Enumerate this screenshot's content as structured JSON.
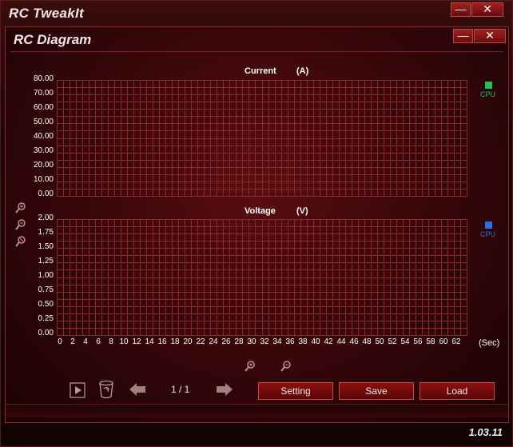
{
  "outer_window": {
    "title": "RC TweakIt",
    "minimize": "—",
    "close": "✕"
  },
  "inner_window": {
    "title": "RC Diagram",
    "minimize": "—",
    "close": "✕"
  },
  "current_chart": {
    "title": "Current",
    "unit": "(A)",
    "y_ticks": [
      "80.00",
      "70.00",
      "60.00",
      "50.00",
      "40.00",
      "30.00",
      "20.00",
      "10.00",
      "0.00"
    ],
    "legend": {
      "label": "CPU",
      "color": "#1fbf5a"
    }
  },
  "voltage_chart": {
    "title": "Voltage",
    "unit": "(V)",
    "y_ticks": [
      "2.00",
      "1.75",
      "1.50",
      "1.25",
      "1.00",
      "0.75",
      "0.50",
      "0.25",
      "0.00"
    ],
    "legend": {
      "label": "CPU",
      "color": "#2b6fe8"
    },
    "x_ticks": [
      "0",
      "2",
      "4",
      "6",
      "8",
      "10",
      "12",
      "14",
      "16",
      "18",
      "20",
      "22",
      "24",
      "26",
      "28",
      "30",
      "32",
      "34",
      "36",
      "38",
      "40",
      "42",
      "44",
      "46",
      "48",
      "50",
      "52",
      "54",
      "56",
      "58",
      "60",
      "62"
    ],
    "x_unit": "(Sec)"
  },
  "chart_data": [
    {
      "type": "line",
      "title": "Current",
      "ylabel": "(A)",
      "ylim": [
        0,
        80
      ],
      "xlim": [
        0,
        62
      ],
      "series": [
        {
          "name": "CPU",
          "values": []
        }
      ],
      "grid": true,
      "legend": "right"
    },
    {
      "type": "line",
      "title": "Voltage",
      "ylabel": "(V)",
      "xlabel": "(Sec)",
      "ylim": [
        0,
        2
      ],
      "xlim": [
        0,
        62
      ],
      "series": [
        {
          "name": "CPU",
          "values": []
        }
      ],
      "grid": true,
      "legend": "right"
    }
  ],
  "toolbar": {
    "pager": "1 / 1",
    "setting_label": "Setting",
    "save_label": "Save",
    "load_label": "Load"
  },
  "icons": {
    "zoom_in": "zoom-in-icon",
    "zoom_reset": "zoom-reset-icon",
    "zoom_out": "zoom-out-icon",
    "play": "play-icon",
    "clear": "recycle-bin-icon",
    "prev": "arrow-left-icon",
    "next": "arrow-right-icon"
  },
  "version": "1.03.11",
  "colors": {
    "grid": "#8a2a2a",
    "button_border": "#c24a4a"
  }
}
